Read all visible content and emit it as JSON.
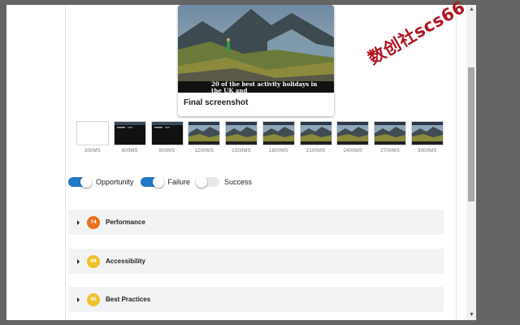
{
  "final_screenshot": {
    "title": "Final screenshot",
    "caption": "20 of the best activity holidays in the UK and"
  },
  "watermark": "数创社scs66",
  "filmstrip": [
    {
      "label": "300MS",
      "kind": "blank"
    },
    {
      "label": "600MS",
      "kind": "dark"
    },
    {
      "label": "900MS",
      "kind": "dark"
    },
    {
      "label": "1200MS",
      "kind": "photo"
    },
    {
      "label": "1500MS",
      "kind": "photo"
    },
    {
      "label": "1800MS",
      "kind": "photo"
    },
    {
      "label": "2100MS",
      "kind": "photo"
    },
    {
      "label": "2400MS",
      "kind": "photo"
    },
    {
      "label": "2700MS",
      "kind": "photo"
    },
    {
      "label": "3000MS",
      "kind": "photo"
    }
  ],
  "filters": {
    "opportunity": {
      "label": "Opportunity",
      "on": true
    },
    "failure": {
      "label": "Failure",
      "on": true
    },
    "success": {
      "label": "Success",
      "on": false
    }
  },
  "categories": [
    {
      "label": "Performance",
      "score": "74",
      "color": "#e8711c"
    },
    {
      "label": "Accessibility",
      "score": "86",
      "color": "#f0c02c"
    },
    {
      "label": "Best Practices",
      "score": "85",
      "color": "#f0c02c"
    }
  ],
  "scrollbar": {
    "thumb_position": 0.33
  }
}
